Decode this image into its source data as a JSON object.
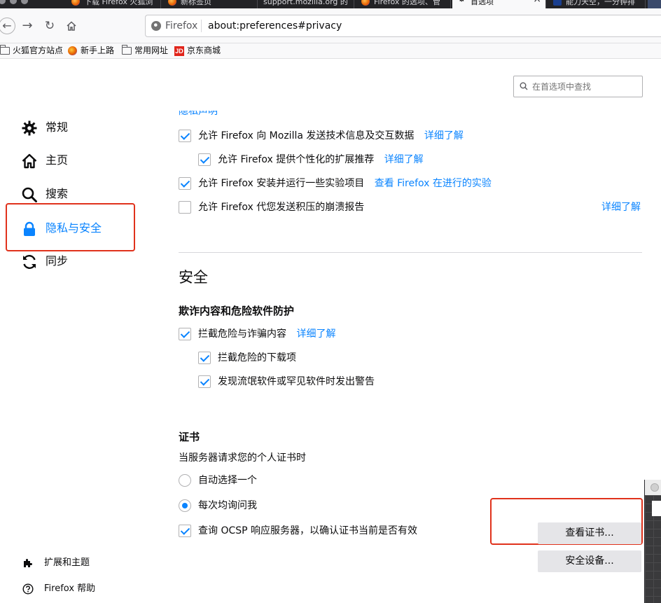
{
  "browser": {
    "tabs": [
      {
        "title": "下载 Firefox 火狐浏"
      },
      {
        "title": "新标签页"
      },
      {
        "title": "support.mozilla.org 的"
      },
      {
        "title": "Firefox 的选项、管"
      },
      {
        "title": "首选项",
        "active": true
      },
      {
        "title": "能力天空，一分钟排"
      }
    ],
    "url_identity": "Firefox",
    "url": "about:preferences#privacy",
    "bookmarks": [
      {
        "label": "火狐官方站点",
        "icon": "folder-icon"
      },
      {
        "label": "新手上路",
        "icon": "firefox-icon"
      },
      {
        "label": "常用网址",
        "icon": "folder-icon"
      },
      {
        "label": "京东商城",
        "icon": "jd-icon"
      }
    ],
    "jd_logo_text": "JD"
  },
  "search": {
    "placeholder": "在首选项中查找"
  },
  "sidebar": {
    "items": [
      {
        "label": "常规",
        "icon": "gear-icon"
      },
      {
        "label": "主页",
        "icon": "home-icon"
      },
      {
        "label": "搜索",
        "icon": "search-icon"
      },
      {
        "label": "隐私与安全",
        "icon": "lock-icon",
        "selected": true
      },
      {
        "label": "同步",
        "icon": "sync-icon"
      }
    ],
    "footer": [
      {
        "label": "扩展和主题",
        "icon": "puzzle-icon"
      },
      {
        "label": "Firefox 帮助",
        "icon": "help-icon"
      }
    ]
  },
  "data_collection": {
    "clipped_heading": "隐私声明",
    "items": [
      {
        "label": "允许 Firefox 向 Mozilla 发送技术信息及交互数据",
        "link": "详细了解",
        "checked": true
      },
      {
        "label": "允许 Firefox 提供个性化的扩展推荐",
        "link": "详细了解",
        "checked": true
      },
      {
        "label": "允许 Firefox 安装并运行一些实验项目",
        "link": "查看 Firefox 在进行的实验",
        "checked": true
      },
      {
        "label": "允许 Firefox 代您发送积压的崩溃报告",
        "link": "详细了解",
        "checked": false
      }
    ]
  },
  "security": {
    "title": "安全",
    "fraud_title": "欺诈内容和危险软件防护",
    "fraud_items": [
      {
        "label": "拦截危险与诈骗内容",
        "link": "详细了解",
        "checked": true
      },
      {
        "label": "拦截危险的下载项",
        "checked": true
      },
      {
        "label": "发现流氓软件或罕见软件时发出警告",
        "checked": true
      }
    ],
    "cert_title": "证书",
    "cert_prompt": "当服务器请求您的个人证书时",
    "cert_options": [
      {
        "label": "自动选择一个",
        "selected": false
      },
      {
        "label": "每次均询问我",
        "selected": true
      }
    ],
    "ocsp_label": "查询 OCSP 响应服务器，以确认证书当前是否有效",
    "ocsp_checked": true,
    "view_certs_button": "查看证书...",
    "security_devices_button": "安全设备..."
  },
  "colors": {
    "accent": "#0a84ff",
    "highlight_box": "#e0321c"
  }
}
